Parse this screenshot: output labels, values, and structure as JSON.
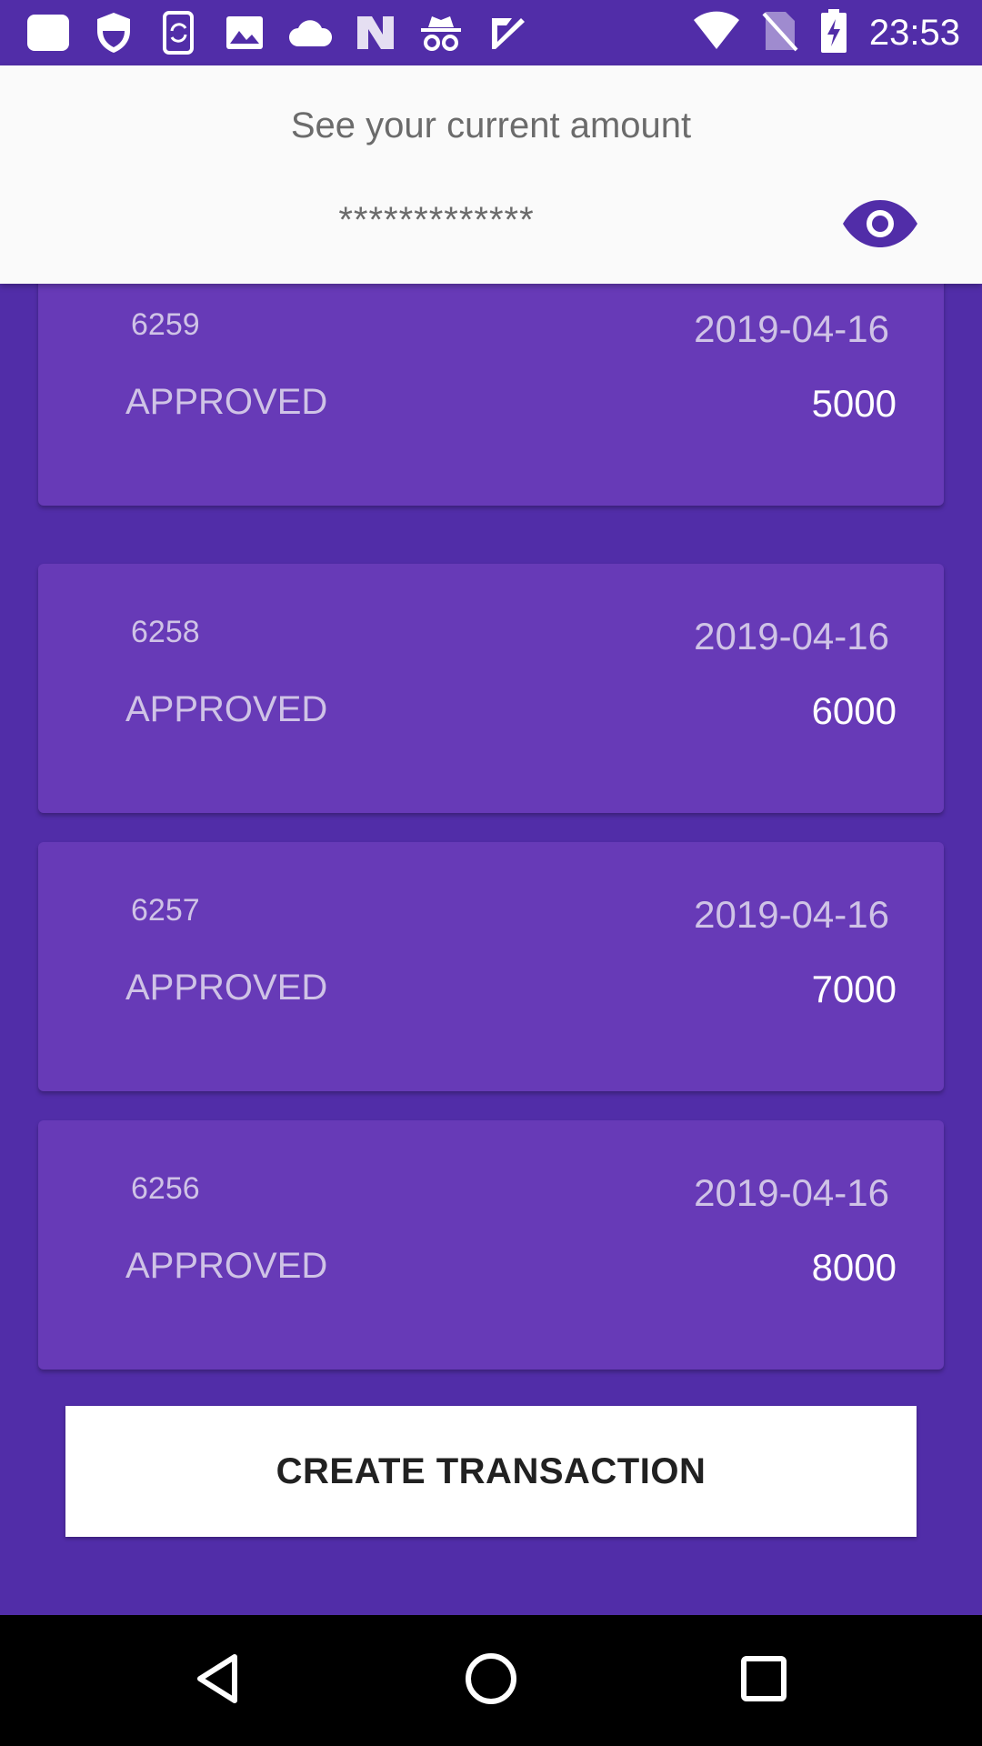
{
  "status_bar": {
    "time": "23:53",
    "left_icons": [
      "notification-icon",
      "shield-icon",
      "phone-sync-icon",
      "image-icon",
      "cloud-icon",
      "n-logo-icon",
      "incognito-icon",
      "checkmark-icon"
    ],
    "right_icons": [
      "wifi-icon",
      "no-sim-icon",
      "battery-charging-icon"
    ]
  },
  "header": {
    "title": "See your current amount",
    "masked_amount": "*************",
    "toggle_icon": "eye-icon"
  },
  "transactions": [
    {
      "id": "6259",
      "date": "2019-04-16",
      "status": "APPROVED",
      "amount": "5000"
    },
    {
      "id": "6258",
      "date": "2019-04-16",
      "status": "APPROVED",
      "amount": "6000"
    },
    {
      "id": "6257",
      "date": "2019-04-16",
      "status": "APPROVED",
      "amount": "7000"
    },
    {
      "id": "6256",
      "date": "2019-04-16",
      "status": "APPROVED",
      "amount": "8000"
    }
  ],
  "actions": {
    "create_label": "CREATE TRANSACTION"
  },
  "nav_bar": {
    "buttons": [
      "back-icon",
      "home-icon",
      "recents-icon"
    ]
  },
  "colors": {
    "primary_dark": "#512DA8",
    "card": "#673AB7",
    "header_bg": "#FAFAFA",
    "accent": "#512DA8"
  }
}
